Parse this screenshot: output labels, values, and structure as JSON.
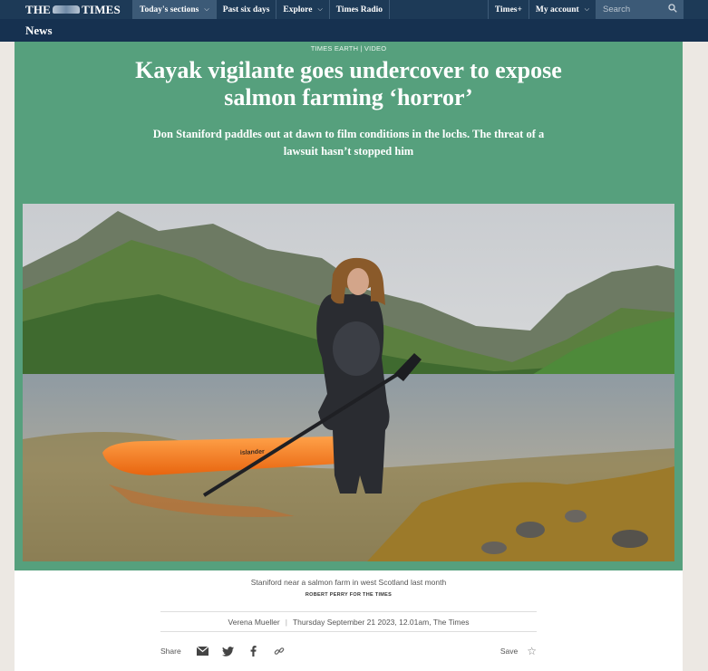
{
  "masthead": {
    "logo_left": "THE",
    "logo_right": "TIMES"
  },
  "nav": {
    "items": [
      {
        "label": "Today's sections",
        "chevron": true,
        "active": true
      },
      {
        "label": "Past six days",
        "chevron": false,
        "active": false
      },
      {
        "label": "Explore",
        "chevron": true,
        "active": false
      },
      {
        "label": "Times Radio",
        "chevron": false,
        "active": false
      }
    ],
    "right_items": [
      {
        "label": "Times+",
        "chevron": false
      },
      {
        "label": "My account",
        "chevron": true
      }
    ],
    "search_placeholder": "Search"
  },
  "section": {
    "title": "News"
  },
  "article": {
    "kicker": "TIMES EARTH | VIDEO",
    "headline": "Kayak vigilante goes undercover to expose salmon farming ‘horror’",
    "standfirst": "Don Staniford paddles out at dawn to film conditions in the lochs. The threat of a lawsuit hasn’t stopped him",
    "kayak_brand": "islander",
    "caption": "Staniford near a salmon farm in west Scotland last month",
    "credit": "ROBERT PERRY FOR THE TIMES",
    "author": "Verena Mueller",
    "dateline": "Thursday September 21 2023, 12.01am, The Times"
  },
  "share": {
    "label": "Share",
    "icons": [
      "email-icon",
      "twitter-icon",
      "facebook-icon",
      "link-icon"
    ],
    "save_label": "Save",
    "save_icon": "star-icon"
  },
  "colors": {
    "nav_bg": "#1d3a57",
    "section_bg": "#163150",
    "hero_green": "#56a07d",
    "page_bg": "#ece8e3"
  }
}
